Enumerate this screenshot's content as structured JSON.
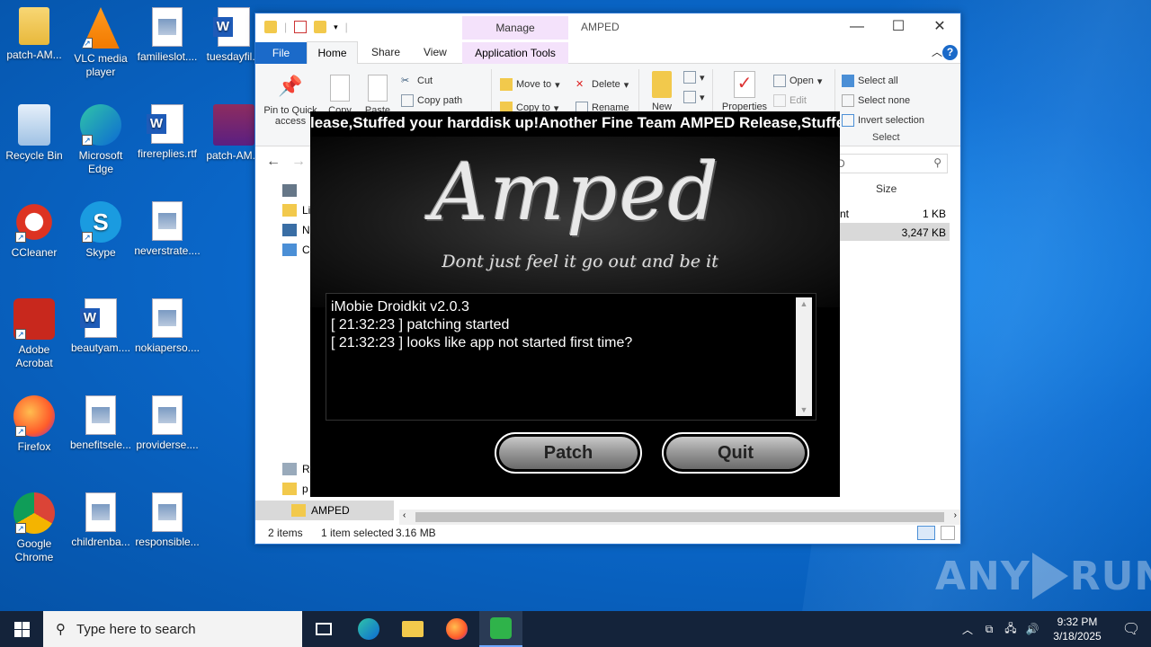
{
  "desktop": {
    "icons": [
      {
        "label": "patch-AM...",
        "icon": "folder-icon"
      },
      {
        "label": "VLC media player",
        "icon": "vlc-icon"
      },
      {
        "label": "familieslot....",
        "icon": "image-file-icon"
      },
      {
        "label": "tuesdayfil...",
        "icon": "word-doc-icon"
      },
      {
        "label": "Recycle Bin",
        "icon": "recycle-bin-icon"
      },
      {
        "label": "Microsoft Edge",
        "icon": "edge-icon"
      },
      {
        "label": "firereplies.rtf",
        "icon": "word-doc-icon"
      },
      {
        "label": "patch-AM...",
        "icon": "winrar-icon"
      },
      {
        "label": "CCleaner",
        "icon": "ccleaner-icon"
      },
      {
        "label": "Skype",
        "icon": "skype-icon"
      },
      {
        "label": "neverstrate....",
        "icon": "image-file-icon"
      },
      {
        "label": "Adobe Acrobat",
        "icon": "acrobat-icon"
      },
      {
        "label": "beautyam....",
        "icon": "word-doc-icon"
      },
      {
        "label": "nokiaperso....",
        "icon": "image-file-icon"
      },
      {
        "label": "Firefox",
        "icon": "firefox-icon"
      },
      {
        "label": "benefitsele...",
        "icon": "image-file-icon"
      },
      {
        "label": "providerse....",
        "icon": "image-file-icon"
      },
      {
        "label": "Google Chrome",
        "icon": "chrome-icon"
      },
      {
        "label": "childrenba...",
        "icon": "image-file-icon"
      },
      {
        "label": "responsible...",
        "icon": "image-file-icon"
      }
    ],
    "watermark": "ANY RUN"
  },
  "explorer": {
    "title": "AMPED",
    "manage_label": "Manage",
    "tabs": {
      "file": "File",
      "home": "Home",
      "share": "Share",
      "view": "View",
      "app_tools": "Application Tools"
    },
    "ribbon": {
      "pin": "Pin to Quick access",
      "copy": "Copy",
      "paste": "Paste",
      "cut": "Cut",
      "copy_path": "Copy path",
      "move_to": "Move to",
      "delete": "Delete",
      "copy_to": "Copy to",
      "rename": "Rename",
      "new": "New",
      "properties": "Properties",
      "open": "Open",
      "edit": "Edit",
      "select_all": "Select all",
      "select_none": "Select none",
      "invert_selection": "Invert selection",
      "select_group": "Select"
    },
    "search_placeholder": "D",
    "columns": {
      "size": "Size"
    },
    "rows": [
      {
        "type_fragment": "nt",
        "size": "1 KB"
      },
      {
        "type_fragment": "",
        "size": "3,247 KB"
      }
    ],
    "nav": {
      "selected_folder": "AMPED"
    },
    "status": {
      "items": "2 items",
      "selected": "1 item selected",
      "size": "3.16 MB"
    }
  },
  "patcher": {
    "scroller_text": "lease,Stuffed your harddisk up!Another Fine Team AMPED Release,Stuffe",
    "logo": "Amped",
    "tagline": "Dont just feel it    go out and be it",
    "log_lines": [
      "iMobie Droidkit v2.0.3",
      "[ 21:32:23 ] patching started",
      "[ 21:32:23 ] looks like app not started first time?"
    ],
    "patch_button": "Patch",
    "quit_button": "Quit"
  },
  "taskbar": {
    "search_placeholder": "Type here to search",
    "time": "9:32 PM",
    "date": "3/18/2025"
  }
}
